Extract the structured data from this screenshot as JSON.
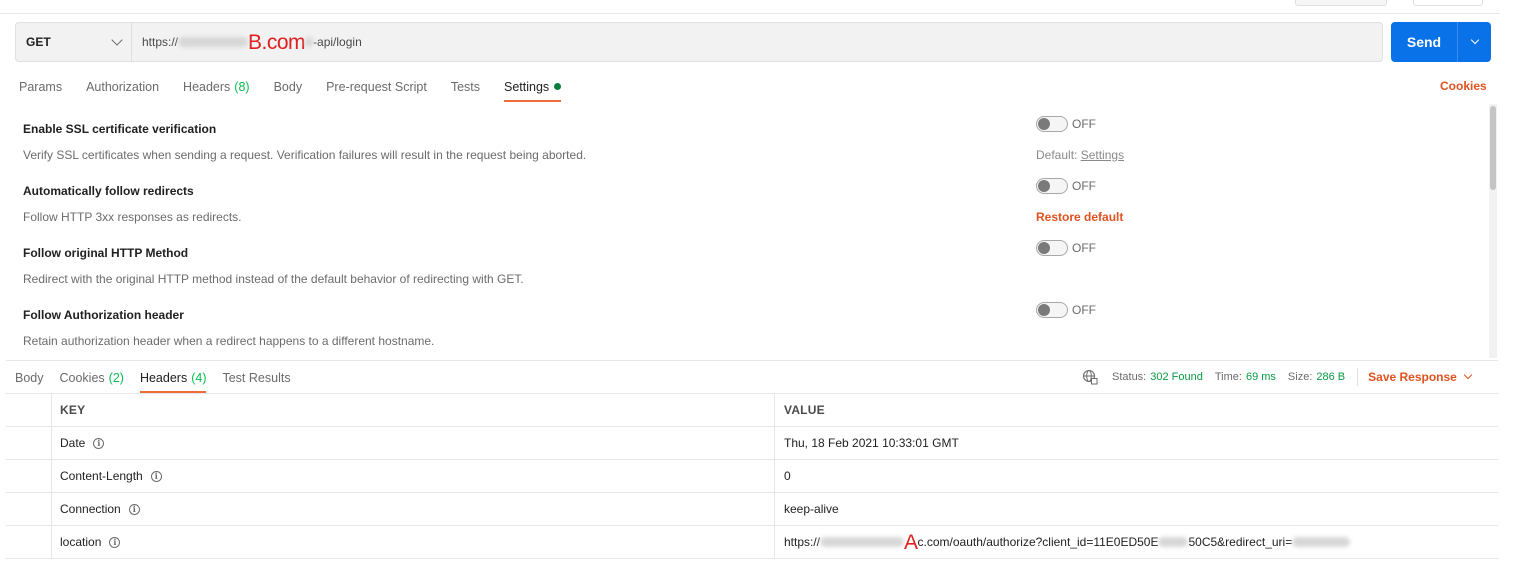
{
  "request": {
    "method": "GET",
    "url_prefix": "https://",
    "url_annotation": "B.com",
    "url_suffix": "-api/login",
    "send_label": "Send"
  },
  "request_tabs": [
    {
      "label": "Params",
      "count": ""
    },
    {
      "label": "Authorization",
      "count": ""
    },
    {
      "label": "Headers",
      "count": "(8)"
    },
    {
      "label": "Body",
      "count": ""
    },
    {
      "label": "Pre-request Script",
      "count": ""
    },
    {
      "label": "Tests",
      "count": ""
    },
    {
      "label": "Settings",
      "count": ""
    }
  ],
  "cookies_label": "Cookies",
  "settings": [
    {
      "title": "Enable SSL certificate verification",
      "description": "Verify SSL certificates when sending a request. Verification failures will result in the request being aborted.",
      "state": "OFF",
      "right_prefix": "Default:",
      "right_link": "Settings"
    },
    {
      "title": "Automatically follow redirects",
      "description": "Follow HTTP 3xx responses as redirects.",
      "state": "OFF",
      "right_action": "Restore default"
    },
    {
      "title": "Follow original HTTP Method",
      "description": "Redirect with the original HTTP method instead of the default behavior of redirecting with GET.",
      "state": "OFF"
    },
    {
      "title": "Follow Authorization header",
      "description": "Retain authorization header when a redirect happens to a different hostname.",
      "state": "OFF"
    }
  ],
  "response_tabs": [
    {
      "label": "Body",
      "count": ""
    },
    {
      "label": "Cookies",
      "count": "(2)"
    },
    {
      "label": "Headers",
      "count": "(4)"
    },
    {
      "label": "Test Results",
      "count": ""
    }
  ],
  "response_meta": {
    "status_label": "Status:",
    "status_value": "302 Found",
    "time_label": "Time:",
    "time_value": "69 ms",
    "size_label": "Size:",
    "size_value": "286 B",
    "save_label": "Save Response"
  },
  "headers_table": {
    "columns": [
      "KEY",
      "VALUE"
    ],
    "rows": [
      {
        "key": "Date",
        "value": "Thu, 18 Feb 2021 10:33:01 GMT"
      },
      {
        "key": "Content-Length",
        "value": "0"
      },
      {
        "key": "Connection",
        "value": "keep-alive"
      },
      {
        "key": "location",
        "value_prefix": "https://",
        "value_annotation": "A",
        "value_suffix": "c.com/oauth/authorize?client_id=11E0ED50E",
        "value_suffix2": "50C5&redirect_uri="
      }
    ]
  },
  "colors": {
    "send_blue": "#0a72e8",
    "accent_orange": "#e05320",
    "tab_underline": "#f26b3a",
    "count_green": "#0cbb52",
    "annotation_red": "#e02020"
  },
  "icons": {
    "method_dropdown": "chevron-down-icon",
    "send_dropdown": "chevron-down-icon",
    "network": "globe-icon",
    "info": "info-icon"
  }
}
